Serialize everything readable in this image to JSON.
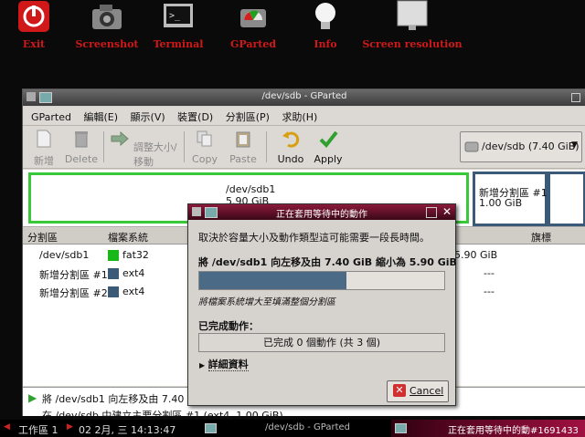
{
  "desktop": {
    "launchers": [
      {
        "label": "Exit",
        "icon": "exit-icon"
      },
      {
        "label": "Screenshot",
        "icon": "camera-icon"
      },
      {
        "label": "Terminal",
        "icon": "terminal-icon"
      },
      {
        "label": "GParted",
        "icon": "gparted-icon"
      },
      {
        "label": "Info",
        "icon": "lightbulb-icon"
      },
      {
        "label": "Screen resolution",
        "icon": "monitor-icon"
      }
    ]
  },
  "window": {
    "title": "/dev/sdb - GParted",
    "menu": [
      "GParted",
      "編輯(E)",
      "顯示(V)",
      "裝置(D)",
      "分割區(P)",
      "求助(H)"
    ],
    "toolbar": {
      "new": "新增",
      "delete": "Delete",
      "resize": "調整大小/移動",
      "copy": "Copy",
      "paste": "Paste",
      "undo": "Undo",
      "apply": "Apply"
    },
    "device_selector": "/dev/sdb  (7.40 GiB)",
    "map": {
      "p1_name": "/dev/sdb1",
      "p1_size": "5.90 GiB",
      "p2_name": "新增分割區 #1",
      "p2_size": "1.00 GiB"
    },
    "columns": {
      "partition": "分割區",
      "filesystem": "檔案系統",
      "size_col": "5.90 GiB",
      "flags": "旗標"
    },
    "rows": [
      {
        "name": "/dev/sdb1",
        "fs": "fat32",
        "color": "#18b818",
        "extra": "5.90 GiB"
      },
      {
        "name": "新增分割區 #1",
        "fs": "ext4",
        "color": "#3a5a78",
        "extra": "---"
      },
      {
        "name": "新增分割區 #2",
        "fs": "ext4",
        "color": "#3a5a78",
        "extra": "---"
      }
    ],
    "ops": {
      "op1": "將 /dev/sdb1 向左移及由 7.40 GiB",
      "op2": "在 /dev/sdb 中建立主要分割區 #1 (ext4, 1.00 GiB)"
    }
  },
  "dialog": {
    "title": "正在套用等待中的動作",
    "intro": "取決於容量大小及動作類型這可能需要一段長時間。",
    "current_op": "將 /dev/sdb1 向左移及由 7.40 GiB 縮小為 5.90 GiB",
    "current_progress": 0.6,
    "sub_status": "將檔案系統增大至填滿整個分割區",
    "completed_label": "已完成動作：",
    "completed_text": "已完成 0 個動作 (共 3 個)",
    "details": "詳細資料",
    "cancel": "Cancel"
  },
  "taskbar": {
    "workspace": "工作區 1",
    "clock": "02 2月, 三 14:13:47",
    "task1": "/dev/sdb - GParted",
    "task2": "正在套用等待中的動#1691433"
  }
}
